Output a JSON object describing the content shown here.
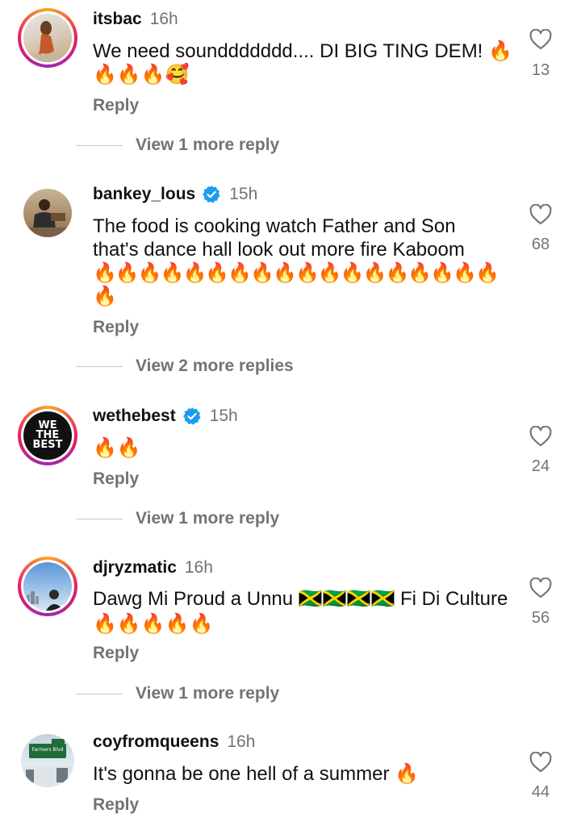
{
  "comments": [
    {
      "username": "itsbac",
      "time": "16h",
      "verified": false,
      "line1": "We need sounddddddd.... DI BIG TING DEM! 🔥",
      "line2": "🔥🔥🔥🥰",
      "reply": "Reply",
      "likes": "13",
      "more": "View 1 more reply"
    },
    {
      "username": "bankey_lous",
      "time": "15h",
      "verified": true,
      "line1": "The food is cooking watch Father and Son",
      "line2": "that's dance hall look out more fire Kaboom",
      "line3": "🔥🔥🔥🔥🔥🔥🔥🔥🔥🔥🔥🔥🔥🔥🔥🔥🔥🔥",
      "line4": "🔥",
      "reply": "Reply",
      "likes": "68",
      "more": "View 2 more replies"
    },
    {
      "username": "wethebest",
      "time": "15h",
      "verified": true,
      "avatar_text": "WE THE BEST",
      "line1": "🔥🔥",
      "reply": "Reply",
      "likes": "24",
      "more": "View 1 more reply"
    },
    {
      "username": "djryzmatic",
      "time": "16h",
      "verified": false,
      "line1": "Dawg Mi Proud a Unnu 🇯🇲🇯🇲🇯🇲🇯🇲 Fi Di Culture",
      "line2": "🔥🔥🔥🔥🔥",
      "reply": "Reply",
      "likes": "56",
      "more": "View 1 more reply"
    },
    {
      "username": "coyfromqueens",
      "time": "16h",
      "verified": false,
      "avatar_sign": "Farmers Blvd",
      "line1": "It's gonna be one hell of a summer 🔥",
      "reply": "Reply",
      "likes": "44"
    }
  ],
  "colors": {
    "accent_verified": "#1d9bf0",
    "muted": "#737373"
  },
  "icons": {
    "like": "heart-outline-icon",
    "verified": "verified-badge-icon"
  }
}
